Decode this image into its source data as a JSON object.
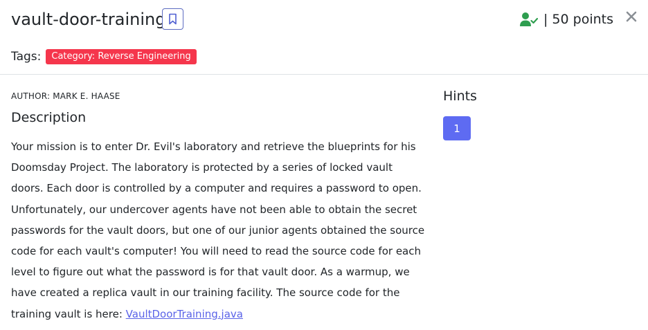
{
  "challenge": {
    "title": "vault-door-training",
    "points_separator": "|",
    "points": "50 points"
  },
  "tags": {
    "label": "Tags:",
    "items": [
      "Category: Reverse Engineering"
    ]
  },
  "author": "AUTHOR: MARK E. HAASE",
  "description": {
    "heading": "Description",
    "text": "Your mission is to enter Dr. Evil's laboratory and retrieve the blueprints for his Doomsday Project. The laboratory is protected by a series of locked vault doors. Each door is controlled by a computer and requires a password to open. Unfortunately, our undercover agents have not been able to obtain the secret passwords for the vault doors, but one of our junior agents obtained the source code for each vault's computer! You will need to read the source code for each level to figure out what the password is for that vault door. As a warmup, we have created a replica vault in our training facility. The source code for the training vault is here: ",
    "link_text": "VaultDoorTraining.java"
  },
  "hints": {
    "heading": "Hints",
    "items": [
      "1"
    ]
  },
  "icons": {
    "bookmark": "bookmark-icon",
    "solved": "user-check-icon",
    "close": "close-icon"
  },
  "colors": {
    "accent": "#5e6bf2",
    "tag": "#f5364c",
    "solved": "#2e9e4f",
    "link": "#5a63e8"
  }
}
